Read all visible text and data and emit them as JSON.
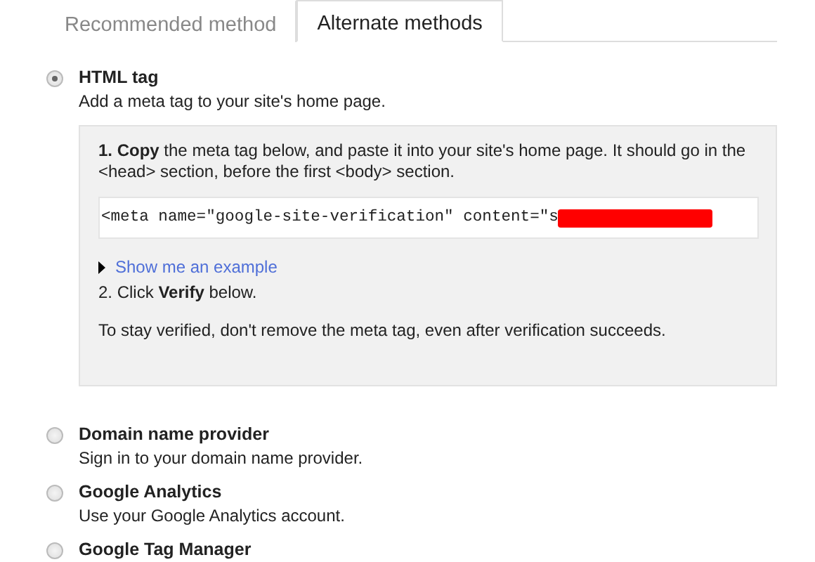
{
  "tabs": [
    {
      "label": "Recommended method",
      "selected": false
    },
    {
      "label": "Alternate methods",
      "selected": true
    }
  ],
  "methods": [
    {
      "title": "HTML tag",
      "description": "Add a meta tag to your site's home page.",
      "selected": true,
      "instructions": {
        "step_1": "**1. Copy** the meta tag below, and paste it into your site's home page. It should go in the <head> section, before the first <body> section.",
        "code": "<meta name=\"google-site-verification\" content=\"s",
        "example_link": "Show me an example",
        "example_expanded": false,
        "step_2": "2. Click **Verify** below.",
        "note": "To stay verified, don't remove the meta tag, even after verification succeeds."
      }
    },
    {
      "title": "Domain name provider",
      "description": "Sign in to your domain name provider.",
      "selected": false
    },
    {
      "title": "Google Analytics",
      "description": "Use your Google Analytics account.",
      "selected": false
    },
    {
      "title": "Google Tag Manager",
      "selected": false
    }
  ]
}
